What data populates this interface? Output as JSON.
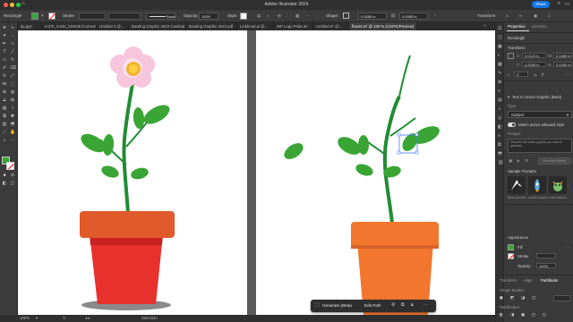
{
  "window": {
    "title": "Adobe Illustrator 2024",
    "share_label": "Share"
  },
  "controlbar": {
    "selection_label": "Rectangle",
    "stroke_label": "Stroke",
    "brush_label": "Basic",
    "opacity_label": "Opacity:",
    "opacity_value": "100%",
    "style_label": "Style:",
    "shape_label": "Shape:",
    "w_value": "0.6385 in",
    "h_value": "0.6385 in",
    "transform_label": "Transform"
  },
  "tabs": [
    "tip.jpg*",
    "m37k_m43s_230428 [Converted].eps*",
    "Untitled-2 @...",
    "Bowling Graphic 2023 Cardinal.pdf",
    "Bowling Graphic 2024.pdf",
    "Linkhead.ai @...",
    "WP Logo Pride.ai*",
    "Untitled-3* @...",
    "flower.ai* @ 100 % (CMYK/Preview)"
  ],
  "panel": {
    "tab_properties": "Properties",
    "tab_libraries": "Libraries",
    "object_type": "Rectangle",
    "transform_header": "Transform",
    "x_value": "5.0123 in",
    "y_value": "4.5085 in",
    "w_value": "0.6385 in",
    "h_value": "0.6385 in",
    "angle_value": "0°",
    "t2v_header": "Text to Vector Graphic (Beta)",
    "type_label": "Type",
    "type_value": "Subject",
    "match_style_label": "Match active artboard style",
    "prompt_label": "Prompt",
    "prompt_placeholder": "Describe the vector graphic you want to generate",
    "generate_label": "Generate (Beta)",
    "sample_prompts_label": "Sample Prompts",
    "sample_captions": [
      "Black and wh...",
      "colorful space...",
      "Cute baby dr..."
    ],
    "appearance_header": "Appearance",
    "fill_label": "Fill",
    "stroke_label": "Stroke",
    "opacity_label": "Opacity",
    "opacity_value": "100%",
    "bottom_tabs": [
      "Transform",
      "Align",
      "Pathfinder"
    ],
    "shape_modes_label": "Shape Modes:",
    "pathfinders_label": "Pathfinders:"
  },
  "contextual_bar": {
    "generate_label": "Generate (Beta)",
    "edit_path_label": "Edit Path"
  },
  "status": {
    "zoom": "100%",
    "tool": "Selection"
  },
  "colors": {
    "fill": "#3aa535",
    "accent": "#1473e6",
    "leaf": "#3aa535",
    "stem": "#228b34",
    "pot_dark": "#e05a2b",
    "pot_light": "#f2762e",
    "pot_red": "#e8302d",
    "petal": "#f7c6dc",
    "center": "#f5b32a"
  }
}
